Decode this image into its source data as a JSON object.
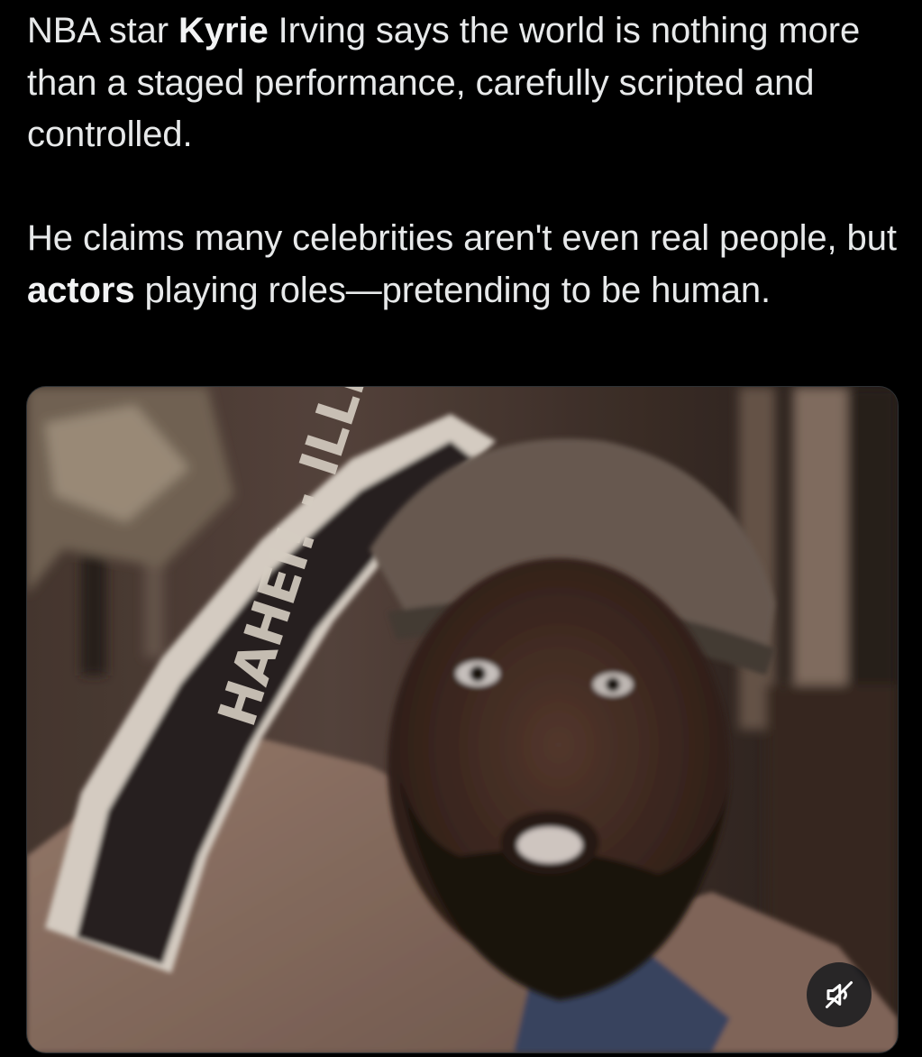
{
  "tweet": {
    "paragraphs": [
      {
        "segments": [
          {
            "text": "NBA star ",
            "bold": false
          },
          {
            "text": "Kyrie",
            "bold": true
          },
          {
            "text": " Irving says the world is nothing more than a staged performance, carefully scripted and controlled.",
            "bold": false
          }
        ]
      },
      {
        "segments": [
          {
            "text": "He claims many celebrities aren't even real people, but ",
            "bold": false
          },
          {
            "text": "actors",
            "bold": true
          },
          {
            "text": " playing roles—pretending to be human.",
            "bold": false
          }
        ]
      }
    ]
  },
  "media": {
    "type": "video",
    "scarf_text": "HAHEI! · ILLIN",
    "mute_icon": "speaker-muted-icon"
  },
  "colors": {
    "background": "#000000",
    "text": "#e7e9ea",
    "mute_button_bg": "#0f1419"
  }
}
